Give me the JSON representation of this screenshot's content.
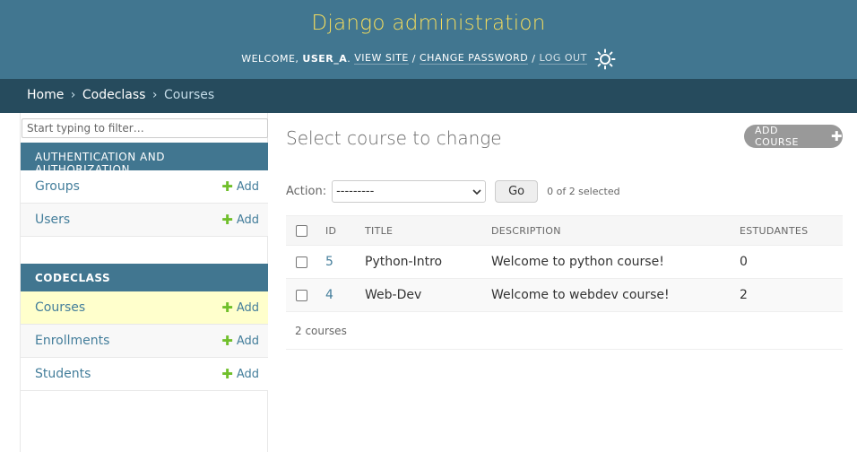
{
  "header": {
    "site_name": "Django administration",
    "welcome": "WELCOME,",
    "username": "USER_A",
    "view_site": "VIEW SITE",
    "change_password": "CHANGE PASSWORD",
    "log_out": "LOG OUT",
    "separator": "/",
    "theme_icon": "sun-icon"
  },
  "breadcrumbs": {
    "home": "Home",
    "app": "Codeclass",
    "current": "Courses",
    "separator": "›"
  },
  "sidebar": {
    "filter_placeholder": "Start typing to filter…",
    "modules": [
      {
        "caption": "AUTHENTICATION AND AUTHORIZATION",
        "models": [
          {
            "name": "Groups",
            "add": "Add"
          },
          {
            "name": "Users",
            "add": "Add"
          }
        ]
      },
      {
        "caption": "CODECLASS",
        "models": [
          {
            "name": "Courses",
            "add": "Add"
          },
          {
            "name": "Enrollments",
            "add": "Add"
          },
          {
            "name": "Students",
            "add": "Add"
          }
        ]
      }
    ]
  },
  "main": {
    "title": "Select course to change",
    "add_button": "ADD COURSE",
    "action_label": "Action:",
    "action_select_value": "---------",
    "go_label": "Go",
    "counter": "0 of 2 selected",
    "columns": [
      "ID",
      "TITLE",
      "DESCRIPTION",
      "ESTUDANTES"
    ],
    "rows": [
      {
        "id": "5",
        "title": "Python-Intro",
        "description": "Welcome to python course!",
        "estudantes": "0"
      },
      {
        "id": "4",
        "title": "Web-Dev",
        "description": "Welcome to webdev course!",
        "estudantes": "2"
      }
    ],
    "paginator": "2 courses"
  },
  "colors": {
    "header_bg": "#417690",
    "breadcrumbs_bg": "#264b5d",
    "site_name": "#f5dd5d",
    "link": "#447e9b",
    "add_plus": "#70bf2b",
    "current_row": "#ffffcc"
  }
}
